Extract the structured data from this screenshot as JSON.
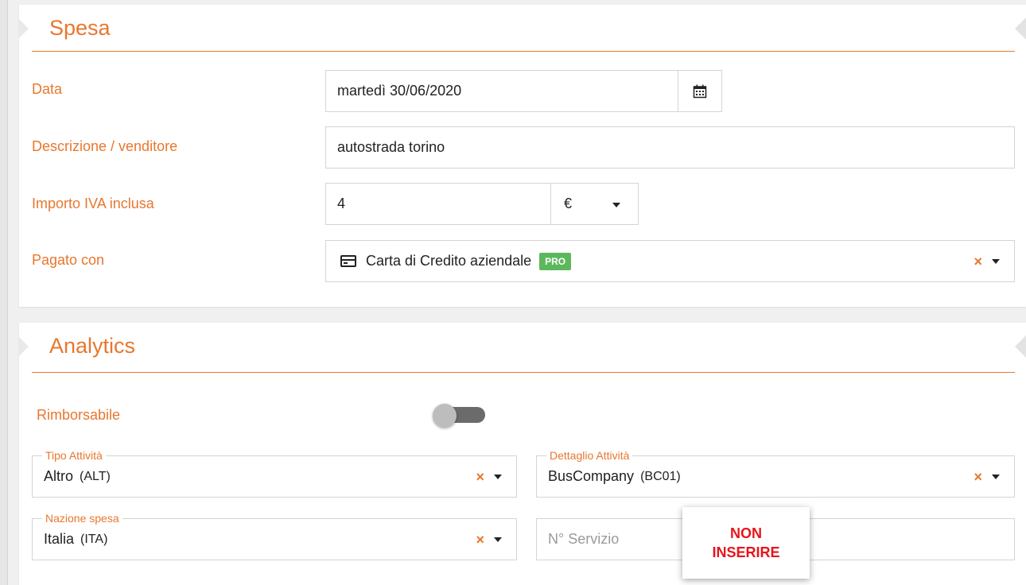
{
  "spesa": {
    "title": "Spesa",
    "data_label": "Data",
    "data_value": "martedì 30/06/2020",
    "descrizione_label": "Descrizione / venditore",
    "descrizione_value": "autostrada torino",
    "importo_label": "Importo IVA inclusa",
    "importo_value": "4",
    "currency": "€",
    "pagato_label": "Pagato con",
    "pagato_value": "Carta di Credito aziendale",
    "pagato_badge": "PRO",
    "clear_symbol": "×"
  },
  "analytics": {
    "title": "Analytics",
    "rimborsabile_label": "Rimborsabile",
    "rimborsabile_on": false,
    "tipo_legend": "Tipo Attività",
    "tipo_value": "Altro",
    "tipo_code": "(ALT)",
    "dettaglio_legend": "Dettaglio Attività",
    "dettaglio_value": "BusCompany",
    "dettaglio_code": "(BC01)",
    "nazione_legend": "Nazione spesa",
    "nazione_value": "Italia",
    "nazione_code": "(ITA)",
    "servizio_placeholder": "N° Servizio",
    "clear_symbol": "×"
  },
  "note": {
    "line1": "NON",
    "line2": "INSERIRE"
  },
  "colors": {
    "accent": "#e8772e",
    "badge_green": "#5cb85c",
    "note_red": "#e8141c"
  }
}
